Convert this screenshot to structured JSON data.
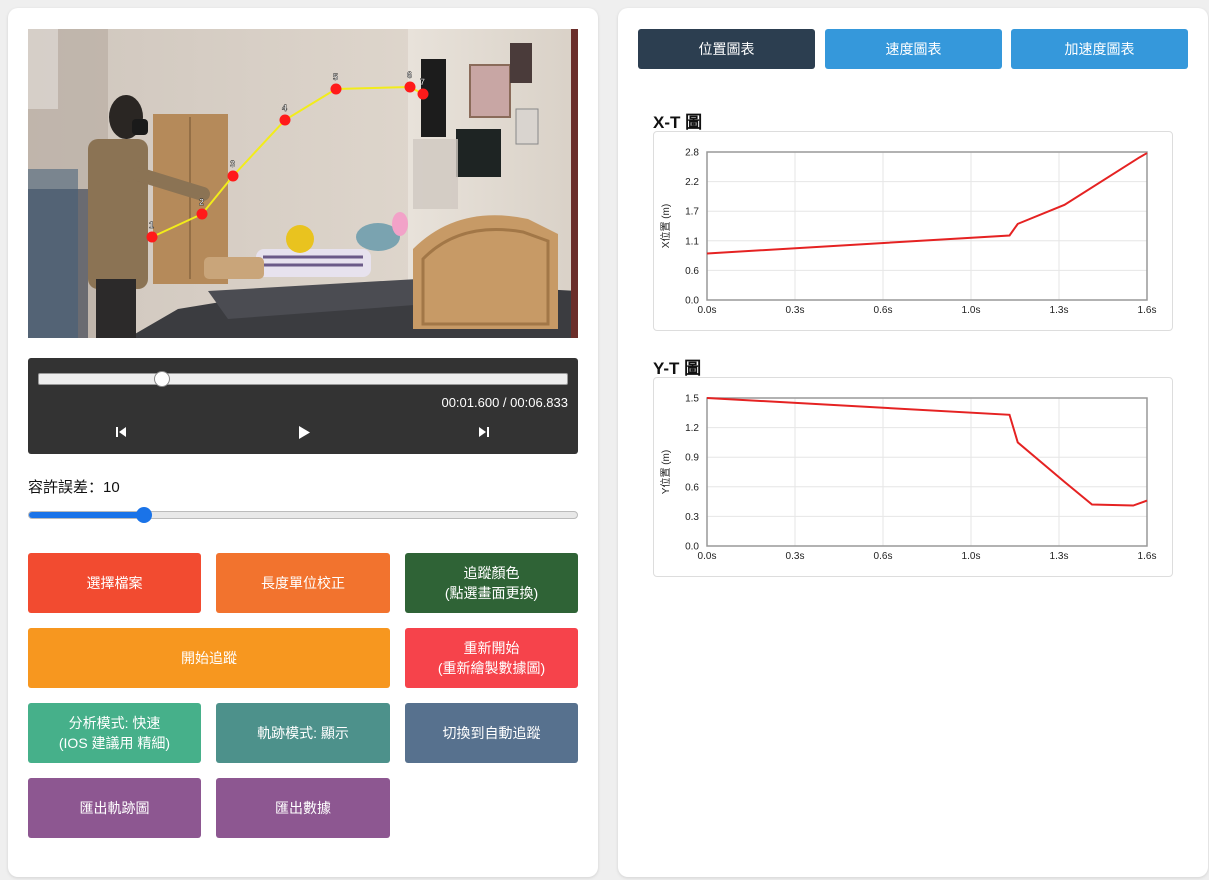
{
  "player": {
    "current_time": "00:01.600",
    "total_time": "00:06.833",
    "time_separator": " / ",
    "progress": 0.234
  },
  "tolerance": {
    "label": "容許誤差：",
    "value": "10",
    "fraction": 0.21
  },
  "video_overlay": {
    "points": [
      {
        "label": "1"
      },
      {
        "label": "2"
      },
      {
        "label": "3"
      },
      {
        "label": "4"
      },
      {
        "label": "5"
      },
      {
        "label": "6"
      },
      {
        "label": "7"
      }
    ],
    "colors": {
      "point": "#ff1a1a",
      "path": "#f2ec1a"
    }
  },
  "buttons": {
    "choose_file": "選擇檔案",
    "calibrate": "長度單位校正",
    "track_color": "追蹤顏色\n(點選畫面更換)",
    "start_tracking": "開始追蹤",
    "restart": "重新開始\n(重新繪製數據圖)",
    "analysis_mode": "分析模式: 快速\n(IOS 建議用 精細)",
    "trail_mode": "軌跡模式: 顯示",
    "switch_auto": "切換到自動追蹤",
    "export_trail": "匯出軌跡圖",
    "export_data": "匯出數據"
  },
  "tabs": {
    "position": "位置圖表",
    "velocity": "速度圖表",
    "acceleration": "加速度圖表"
  },
  "colors": {
    "red": "#f24b30",
    "orange": "#f2732e",
    "dark_green": "#2f6336",
    "amber": "#f7971f",
    "coral_red": "#f6434b",
    "teal_green": "#46b08a",
    "teal": "#4d918b",
    "slate": "#57718e",
    "purple": "#8d5791",
    "tab_active": "#2c3e50",
    "tab_inactive": "#3598db",
    "line": "#e52222"
  },
  "chart_data": [
    {
      "type": "line",
      "title": "X-T 圖",
      "ylabel": "X位置 (m)",
      "xlabel": "",
      "x_ticks": [
        "0.0s",
        "0.3s",
        "0.6s",
        "1.0s",
        "1.3s",
        "1.6s"
      ],
      "y_ticks": [
        "0.0",
        "0.6",
        "1.1",
        "1.7",
        "2.2",
        "2.8"
      ],
      "xlim": [
        0,
        1.6
      ],
      "ylim": [
        0,
        2.8
      ],
      "grid": true,
      "series": [
        {
          "x": [
            0.0,
            1.1,
            1.13,
            1.3,
            1.57,
            1.6
          ],
          "values": [
            0.88,
            1.22,
            1.44,
            1.8,
            2.69,
            2.78
          ]
        }
      ]
    },
    {
      "type": "line",
      "title": "Y-T 圖",
      "ylabel": "Y位置 (m)",
      "xlabel": "",
      "x_ticks": [
        "0.0s",
        "0.3s",
        "0.6s",
        "1.0s",
        "1.3s",
        "1.6s"
      ],
      "y_ticks": [
        "0.0",
        "0.3",
        "0.6",
        "0.9",
        "1.2",
        "1.5"
      ],
      "xlim": [
        0,
        1.6
      ],
      "ylim": [
        0,
        1.5
      ],
      "grid": true,
      "series": [
        {
          "x": [
            0.0,
            1.1,
            1.13,
            1.3,
            1.4,
            1.55,
            1.6
          ],
          "values": [
            1.5,
            1.33,
            1.05,
            0.65,
            0.42,
            0.41,
            0.46
          ]
        }
      ]
    }
  ]
}
